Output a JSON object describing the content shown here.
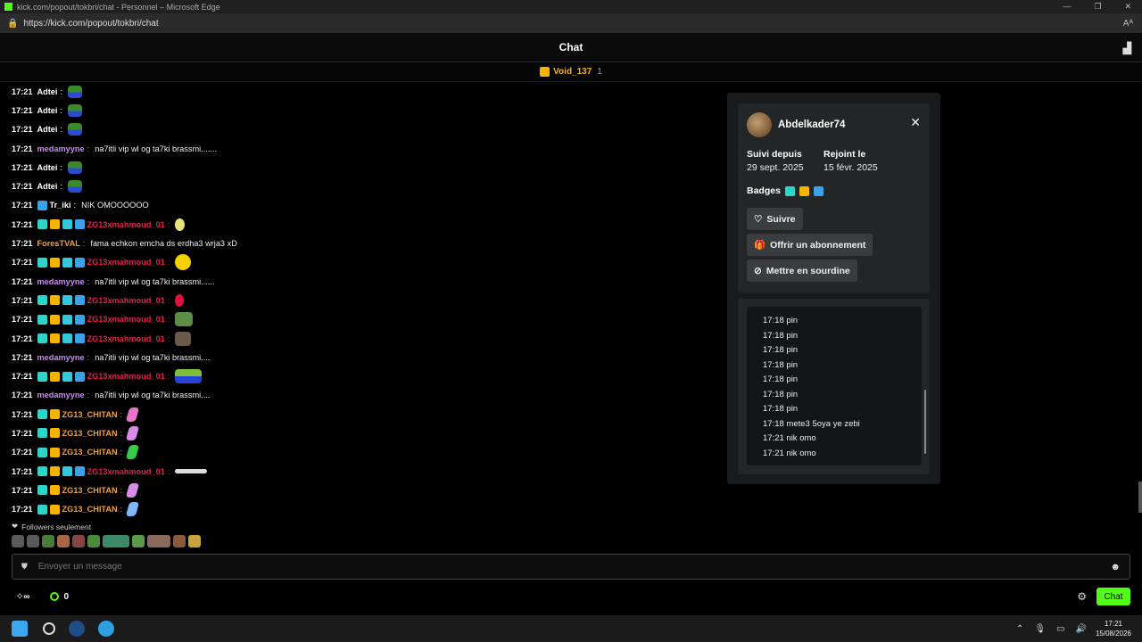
{
  "window": {
    "title": "kick.com/popout/tokbri/chat - Personnel – Microsoft Edge",
    "url": "https://kick.com/popout/tokbri/chat",
    "reader_icon": "Aᴬ"
  },
  "header": {
    "title": "Chat"
  },
  "pinned": {
    "user": "Void_137",
    "count": "1"
  },
  "messages": [
    {
      "time": "17:21",
      "user": "Adtei",
      "color": "#ffffff",
      "badges": [],
      "text": "",
      "emote": "em-frog"
    },
    {
      "time": "17:21",
      "user": "Adtei",
      "color": "#ffffff",
      "badges": [],
      "text": "",
      "emote": "em-frog"
    },
    {
      "time": "17:21",
      "user": "Adtei",
      "color": "#ffffff",
      "badges": [],
      "text": "",
      "emote": "em-frog"
    },
    {
      "time": "17:21",
      "user": "medamyyne",
      "color": "#c98af0",
      "badges": [],
      "text": "na7itli vip wl og ta7ki brassmi.......",
      "emote": ""
    },
    {
      "time": "17:21",
      "user": "Adtei",
      "color": "#ffffff",
      "badges": [],
      "text": "",
      "emote": "em-frog"
    },
    {
      "time": "17:21",
      "user": "Adtei",
      "color": "#ffffff",
      "badges": [],
      "text": "",
      "emote": "em-frog"
    },
    {
      "time": "17:21",
      "user": "Tr_iki",
      "color": "#ffffff",
      "badges": [
        "b-arrow"
      ],
      "text": "NIK OMOOOOOO",
      "emote": ""
    },
    {
      "time": "17:21",
      "user": "ZG13xmahmoud_01",
      "color": "#e0204a",
      "badges": [
        "b-sub",
        "b-crown",
        "b-gift",
        "b-arrow"
      ],
      "text": "",
      "emote": "em-yellow"
    },
    {
      "time": "17:21",
      "user": "ForesTVAL",
      "color": "#f0a040",
      "badges": [],
      "text": "fama echkon emcha ds erdha3 wrja3 xD",
      "emote": ""
    },
    {
      "time": "17:21",
      "user": "ZG13xmahmoud_01",
      "color": "#e0204a",
      "badges": [
        "b-sub",
        "b-crown",
        "b-gift",
        "b-arrow"
      ],
      "text": "",
      "emote": "em-face"
    },
    {
      "time": "17:21",
      "user": "medamyyne",
      "color": "#c98af0",
      "badges": [],
      "text": "na7itli vip wl og ta7ki brassmi......",
      "emote": ""
    },
    {
      "time": "17:21",
      "user": "ZG13xmahmoud_01",
      "color": "#e0204a",
      "badges": [
        "b-sub",
        "b-crown",
        "b-gift",
        "b-arrow"
      ],
      "text": "",
      "emote": "em-red"
    },
    {
      "time": "17:21",
      "user": "ZG13xmahmoud_01",
      "color": "#e0204a",
      "badges": [
        "b-sub",
        "b-crown",
        "b-gift",
        "b-arrow"
      ],
      "text": "",
      "emote": "em-frog2"
    },
    {
      "time": "17:21",
      "user": "ZG13xmahmoud_01",
      "color": "#e0204a",
      "badges": [
        "b-sub",
        "b-crown",
        "b-gift",
        "b-arrow"
      ],
      "text": "",
      "emote": "em-cat"
    },
    {
      "time": "17:21",
      "user": "medamyyne",
      "color": "#c98af0",
      "badges": [],
      "text": "na7itli vip wl og ta7ki brassmi....",
      "emote": ""
    },
    {
      "time": "17:21",
      "user": "ZG13xmahmoud_01",
      "color": "#e0204a",
      "badges": [
        "b-sub",
        "b-crown",
        "b-gift",
        "b-arrow"
      ],
      "text": "",
      "emote": "em-bowl"
    },
    {
      "time": "17:21",
      "user": "medamyyne",
      "color": "#c98af0",
      "badges": [],
      "text": "na7itli vip wl og ta7ki brassmi....",
      "emote": ""
    },
    {
      "time": "17:21",
      "user": "ZG13_CHITAN",
      "color": "#f0a040",
      "badges": [
        "b-sub",
        "b-crown"
      ],
      "text": "",
      "emote": "em-pink"
    },
    {
      "time": "17:21",
      "user": "ZG13_CHITAN",
      "color": "#f0a040",
      "badges": [
        "b-sub",
        "b-crown"
      ],
      "text": "",
      "emote": "em-lilac"
    },
    {
      "time": "17:21",
      "user": "ZG13_CHITAN",
      "color": "#f0a040",
      "badges": [
        "b-sub",
        "b-crown"
      ],
      "text": "",
      "emote": "em-green"
    },
    {
      "time": "17:21",
      "user": "ZG13xmahmoud_01",
      "color": "#e0204a",
      "badges": [
        "b-sub",
        "b-crown",
        "b-gift",
        "b-arrow"
      ],
      "text": "",
      "emote": "em-white"
    },
    {
      "time": "17:21",
      "user": "ZG13_CHITAN",
      "color": "#f0a040",
      "badges": [
        "b-sub",
        "b-crown"
      ],
      "text": "",
      "emote": "em-lilac"
    },
    {
      "time": "17:21",
      "user": "ZG13_CHITAN",
      "color": "#f0a040",
      "badges": [
        "b-sub",
        "b-crown"
      ],
      "text": "",
      "emote": "em-blue"
    }
  ],
  "followers_only": "Followers seulement",
  "input": {
    "placeholder": "Envoyer un message"
  },
  "bottom": {
    "points": "0",
    "chat_button": "Chat"
  },
  "card": {
    "username": "Abdelkader74",
    "followed_label": "Suivi depuis",
    "followed_value": "29 sept. 2025",
    "joined_label": "Rejoint le",
    "joined_value": "15 févr. 2025",
    "badges_label": "Badges",
    "follow_button": "Suivre",
    "gift_button": "Offrir un abonnement",
    "mute_button": "Mettre en sourdine",
    "history": [
      "17:18 pin",
      "17:18 pin",
      "17:18 pin",
      "17:18 pin",
      "17:18 pin",
      "17:18 pin",
      "17:18 pin",
      "17:18 mete3 5oya ye zebi",
      "17:21 nik omo",
      "17:21 nik omo"
    ]
  },
  "taskbar": {
    "time": "17:21",
    "date": "15/08/2026"
  },
  "colors": {
    "accent": "#53fc18",
    "gold": "#f4b400"
  }
}
